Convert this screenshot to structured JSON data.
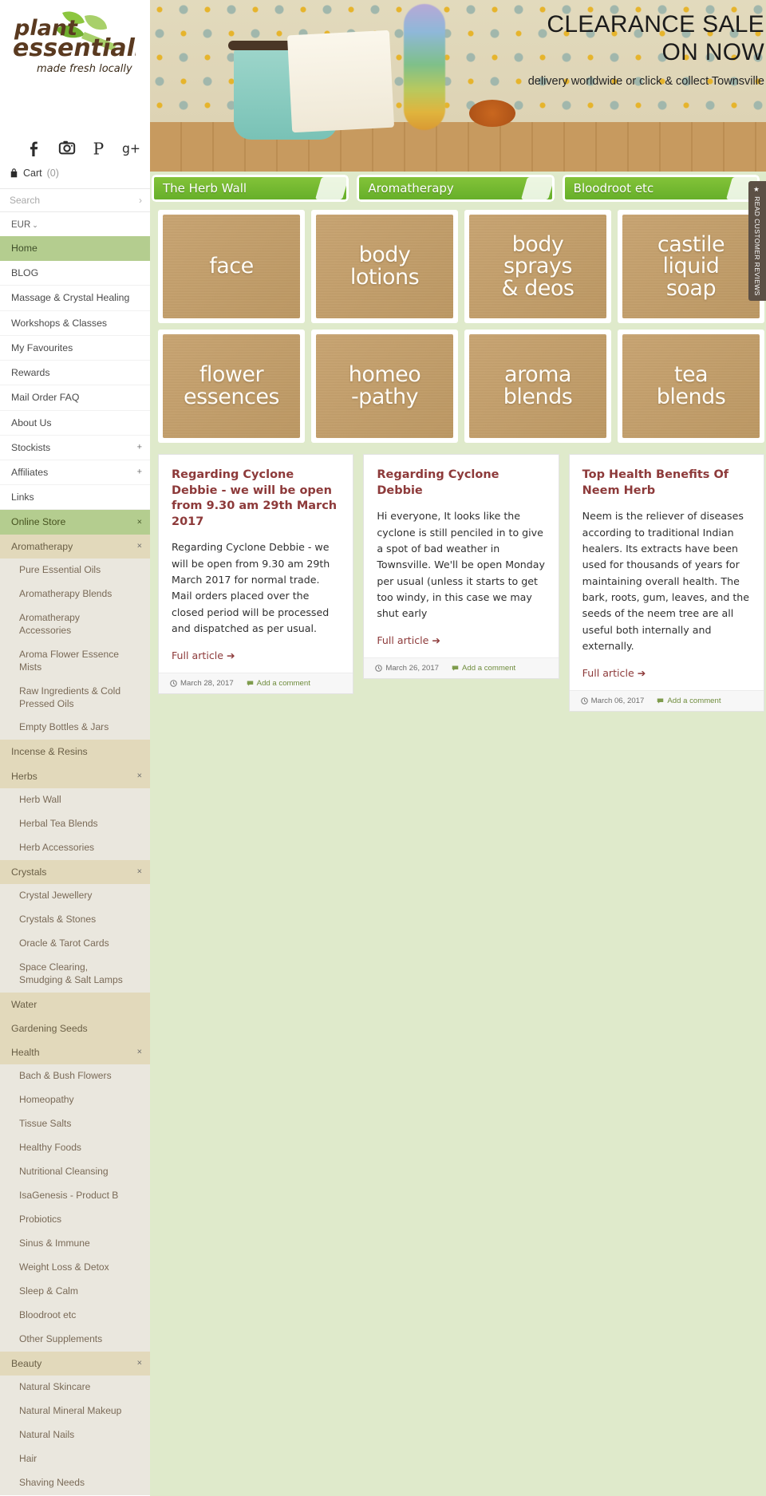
{
  "brand": {
    "name_line1": "plant",
    "name_line2": "essentials",
    "tagline": "made fresh locally"
  },
  "social": [
    {
      "name": "facebook-icon",
      "label": "Facebook"
    },
    {
      "name": "instagram-icon",
      "label": "Instagram"
    },
    {
      "name": "pinterest-icon",
      "label": "Pinterest"
    },
    {
      "name": "googleplus-icon",
      "label": "Google Plus"
    }
  ],
  "cart": {
    "label": "Cart",
    "count": "(0)"
  },
  "search": {
    "placeholder": "Search",
    "value": "",
    "arrow": "›"
  },
  "currency": {
    "selected": "EUR",
    "caret": "⌄"
  },
  "nav": [
    {
      "label": "Home",
      "type": "home-active",
      "marker": ""
    },
    {
      "label": "BLOG",
      "type": "plain",
      "marker": ""
    },
    {
      "label": "Massage & Crystal Healing",
      "type": "plain",
      "marker": ""
    },
    {
      "label": "Workshops & Classes",
      "type": "plain",
      "marker": ""
    },
    {
      "label": "My Favourites",
      "type": "plain",
      "marker": ""
    },
    {
      "label": "Rewards",
      "type": "plain",
      "marker": ""
    },
    {
      "label": "Mail Order FAQ",
      "type": "plain",
      "marker": ""
    },
    {
      "label": "About Us",
      "type": "plain",
      "marker": ""
    },
    {
      "label": "Stockists",
      "type": "plain",
      "marker": "+"
    },
    {
      "label": "Affiliates",
      "type": "plain",
      "marker": "+"
    },
    {
      "label": "Links",
      "type": "plain",
      "marker": ""
    },
    {
      "label": "Online Store",
      "type": "store",
      "marker": "×"
    },
    {
      "label": "Aromatherapy",
      "type": "cat",
      "marker": "×"
    },
    {
      "label": "Pure Essential Oils",
      "type": "sub",
      "marker": ""
    },
    {
      "label": "Aromatherapy Blends",
      "type": "sub",
      "marker": ""
    },
    {
      "label": "Aromatherapy Accessories",
      "type": "sub",
      "marker": ""
    },
    {
      "label": "Aroma Flower Essence Mists",
      "type": "sub",
      "marker": ""
    },
    {
      "label": "Raw Ingredients & Cold Pressed Oils",
      "type": "sub",
      "marker": ""
    },
    {
      "label": "Empty Bottles & Jars",
      "type": "sub",
      "marker": ""
    },
    {
      "label": "Incense & Resins",
      "type": "cat",
      "marker": ""
    },
    {
      "label": "Herbs",
      "type": "cat",
      "marker": "×"
    },
    {
      "label": "Herb Wall",
      "type": "sub",
      "marker": ""
    },
    {
      "label": "Herbal Tea Blends",
      "type": "sub",
      "marker": ""
    },
    {
      "label": "Herb Accessories",
      "type": "sub",
      "marker": ""
    },
    {
      "label": "Crystals",
      "type": "cat",
      "marker": "×"
    },
    {
      "label": "Crystal Jewellery",
      "type": "sub",
      "marker": ""
    },
    {
      "label": "Crystals & Stones",
      "type": "sub",
      "marker": ""
    },
    {
      "label": "Oracle & Tarot Cards",
      "type": "sub",
      "marker": ""
    },
    {
      "label": "Space Clearing, Smudging & Salt Lamps",
      "type": "sub",
      "marker": ""
    },
    {
      "label": "Water",
      "type": "cat",
      "marker": ""
    },
    {
      "label": "Gardening Seeds",
      "type": "cat",
      "marker": ""
    },
    {
      "label": "Health",
      "type": "cat",
      "marker": "×"
    },
    {
      "label": "Bach & Bush Flowers",
      "type": "sub",
      "marker": ""
    },
    {
      "label": "Homeopathy",
      "type": "sub",
      "marker": ""
    },
    {
      "label": "Tissue Salts",
      "type": "sub",
      "marker": ""
    },
    {
      "label": "Healthy Foods",
      "type": "sub",
      "marker": ""
    },
    {
      "label": "Nutritional Cleansing",
      "type": "sub",
      "marker": ""
    },
    {
      "label": "IsaGenesis - Product B",
      "type": "sub",
      "marker": ""
    },
    {
      "label": "Probiotics",
      "type": "sub",
      "marker": ""
    },
    {
      "label": "Sinus & Immune",
      "type": "sub",
      "marker": ""
    },
    {
      "label": "Weight Loss & Detox",
      "type": "sub",
      "marker": ""
    },
    {
      "label": "Sleep & Calm",
      "type": "sub",
      "marker": ""
    },
    {
      "label": "Bloodroot etc",
      "type": "sub",
      "marker": ""
    },
    {
      "label": "Other Supplements",
      "type": "sub",
      "marker": ""
    },
    {
      "label": "Beauty",
      "type": "cat",
      "marker": "×"
    },
    {
      "label": "Natural Skincare",
      "type": "sub",
      "marker": ""
    },
    {
      "label": "Natural Mineral Makeup",
      "type": "sub",
      "marker": ""
    },
    {
      "label": "Natural Nails",
      "type": "sub",
      "marker": ""
    },
    {
      "label": "Hair",
      "type": "sub",
      "marker": ""
    },
    {
      "label": "Shaving Needs",
      "type": "sub",
      "marker": ""
    }
  ],
  "hero": {
    "title_line1": "CLEARANCE SALE",
    "title_line2": "ON NOW",
    "subtitle": "delivery worldwide or click & collect Townsville"
  },
  "tabs": [
    {
      "label": "The Herb Wall"
    },
    {
      "label": "Aromatherapy"
    },
    {
      "label": "Bloodroot etc"
    }
  ],
  "tiles": [
    {
      "label": "face"
    },
    {
      "label": "body\nlotions"
    },
    {
      "label": "body\nsprays\n& deos"
    },
    {
      "label": "castile\nliquid\nsoap"
    },
    {
      "label": "flower\nessences"
    },
    {
      "label": "homeo\n-pathy"
    },
    {
      "label": "aroma\nblends"
    },
    {
      "label": "tea\nblends"
    }
  ],
  "blog": {
    "read_more_label": "Full article ➔",
    "comment_label": "Add a comment",
    "posts": [
      {
        "title": "Regarding Cyclone Debbie - we will be open from 9.30 am 29th March 2017",
        "body": "Regarding Cyclone Debbie - we will be open from 9.30 am 29th March 2017 for normal trade.  Mail orders placed over the closed period will be processed and dispatched as per usual.",
        "date": "March 28, 2017"
      },
      {
        "title": "Regarding Cyclone Debbie",
        "body": "Hi everyone,  It looks like the cyclone is still penciled in to give a spot of bad weather in Townsville. We'll be open Monday per usual (unless it starts to get too windy, in this case we may shut early",
        "date": "March 26, 2017"
      },
      {
        "title": "Top Health Benefits Of Neem Herb",
        "body": "Neem is the reliever of diseases according to traditional Indian healers. Its extracts have been used for thousands of years for maintaining overall health. The bark, roots, gum, leaves, and the seeds of the neem tree are all useful both internally and externally.",
        "date": "March 06, 2017"
      }
    ]
  },
  "reviews_tab": {
    "label": "★ READ CUSTOMER REVIEWS"
  },
  "colors": {
    "sidebar_active_green": "#b4cd8f",
    "category_tan": "#e2d9bb",
    "subitem_beige": "#eae7de",
    "page_green": "#dfeacb",
    "blog_title_red": "#8d3a3a",
    "tab_green": "#6fba2e"
  }
}
